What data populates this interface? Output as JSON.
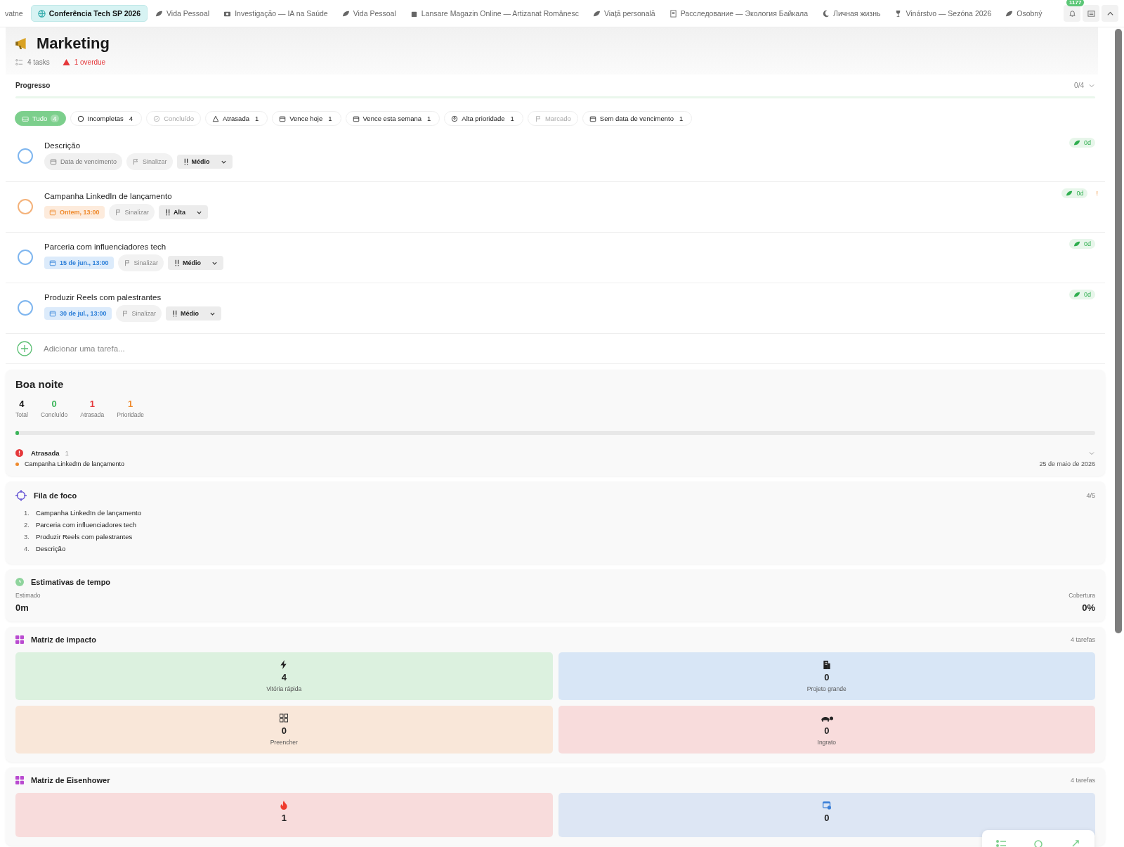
{
  "tabs": [
    {
      "label": "vatne",
      "selected": false
    },
    {
      "label": "Conferência Tech SP 2026",
      "selected": true
    },
    {
      "label": "Vida Pessoal",
      "selected": false
    },
    {
      "label": "Investigação — IA na Saúde",
      "selected": false
    },
    {
      "label": "Vida Pessoal",
      "selected": false
    },
    {
      "label": "Lansare Magazin Online — Artizanat Românesc",
      "selected": false
    },
    {
      "label": "Viață personală",
      "selected": false
    },
    {
      "label": "Расследование — Экология Байкала",
      "selected": false
    },
    {
      "label": "Личная жизнь",
      "selected": false
    },
    {
      "label": "Vinárstvo — Sezóna 2026",
      "selected": false
    },
    {
      "label": "Osobný",
      "selected": false
    }
  ],
  "notifications": {
    "badge": "1177"
  },
  "header": {
    "title": "Marketing",
    "tasks": "4 tasks",
    "overdue": "1 overdue"
  },
  "progress": {
    "label": "Progresso",
    "count": "0/4"
  },
  "filters": [
    {
      "label": "Tudo",
      "count": "4",
      "selected": true,
      "disabled": false
    },
    {
      "label": "Incompletas",
      "count": "4",
      "selected": false,
      "disabled": false
    },
    {
      "label": "Concluído",
      "selected": false,
      "disabled": true
    },
    {
      "label": "Atrasada",
      "count": "1",
      "selected": false,
      "disabled": false
    },
    {
      "label": "Vence hoje",
      "count": "1",
      "selected": false,
      "disabled": false
    },
    {
      "label": "Vence esta semana",
      "count": "1",
      "selected": false,
      "disabled": false
    },
    {
      "label": "Alta prioridade",
      "count": "1",
      "selected": false,
      "disabled": false
    },
    {
      "label": "Marcado",
      "selected": false,
      "disabled": true
    },
    {
      "label": "Sem data de vencimento",
      "count": "1",
      "selected": false,
      "disabled": false
    }
  ],
  "tasks": [
    {
      "title": "Descrição",
      "due": {
        "text": "Data de vencimento",
        "kind": "none"
      },
      "flag": "Sinalizar",
      "priority": {
        "label": "Médio",
        "kind": "medium"
      },
      "age": "0d"
    },
    {
      "title": "Campanha LinkedIn de lançamento",
      "due": {
        "text": "Ontem, 13:00",
        "kind": "overdue"
      },
      "flag": "Sinalizar",
      "priority": {
        "label": "Alta",
        "kind": "high"
      },
      "age": "0d",
      "alert": "!"
    },
    {
      "title": "Parceria com influenciadores tech",
      "due": {
        "text": "15 de jun., 13:00",
        "kind": "upcoming"
      },
      "flag": "Sinalizar",
      "priority": {
        "label": "Médio",
        "kind": "medium"
      },
      "age": "0d"
    },
    {
      "title": "Produzir Reels com palestrantes",
      "due": {
        "text": "30 de jul., 13:00",
        "kind": "upcoming"
      },
      "flag": "Sinalizar",
      "priority": {
        "label": "Médio",
        "kind": "medium"
      },
      "age": "0d"
    }
  ],
  "add_task": {
    "placeholder": "Adicionar uma tarefa..."
  },
  "summary": {
    "title": "Boa noite",
    "stats": [
      {
        "value": "4",
        "label": "Total",
        "color": "#111111"
      },
      {
        "value": "0",
        "label": "Concluído",
        "color": "#3cb55a"
      },
      {
        "value": "1",
        "label": "Atrasada",
        "color": "#e5383b"
      },
      {
        "value": "1",
        "label": "Prioridade",
        "color": "#ef8a2d"
      }
    ],
    "level": 0.003,
    "overdue": {
      "title": "Atrasada",
      "count": "1",
      "items": [
        {
          "title": "Campanha LinkedIn de lançamento",
          "date": "25 de maio de 2026"
        }
      ]
    }
  },
  "focus": {
    "title": "Fila de foco",
    "count": "4/5",
    "items": [
      {
        "n": "1.",
        "title": "Campanha LinkedIn de lançamento"
      },
      {
        "n": "2.",
        "title": "Parceria com influenciadores tech"
      },
      {
        "n": "3.",
        "title": "Produzir Reels com palestrantes"
      },
      {
        "n": "4.",
        "title": "Descrição"
      }
    ]
  },
  "estimates": {
    "title": "Estimativas de tempo",
    "estimated_label": "Estimado",
    "estimated": "0m",
    "coverage_label": "Cobertura",
    "coverage": "0%"
  },
  "impact": {
    "title": "Matriz de impacto",
    "count": "4 tarefas",
    "quadrants": [
      {
        "value": "4",
        "label": "Vitória rápida",
        "color": "#dcf1df"
      },
      {
        "value": "0",
        "label": "Projeto grande",
        "color": "#d8e6f6"
      },
      {
        "value": "0",
        "label": "Preencher",
        "color": "#f9e7d9"
      },
      {
        "value": "0",
        "label": "Ingrato",
        "color": "#f8dcdc"
      }
    ]
  },
  "eisenhower": {
    "title": "Matriz de Eisenhower",
    "count": "4 tarefas",
    "quadrants": [
      {
        "value": "1",
        "color": "#f8dcdc"
      },
      {
        "value": "0",
        "color": "#dde6f4"
      }
    ]
  }
}
